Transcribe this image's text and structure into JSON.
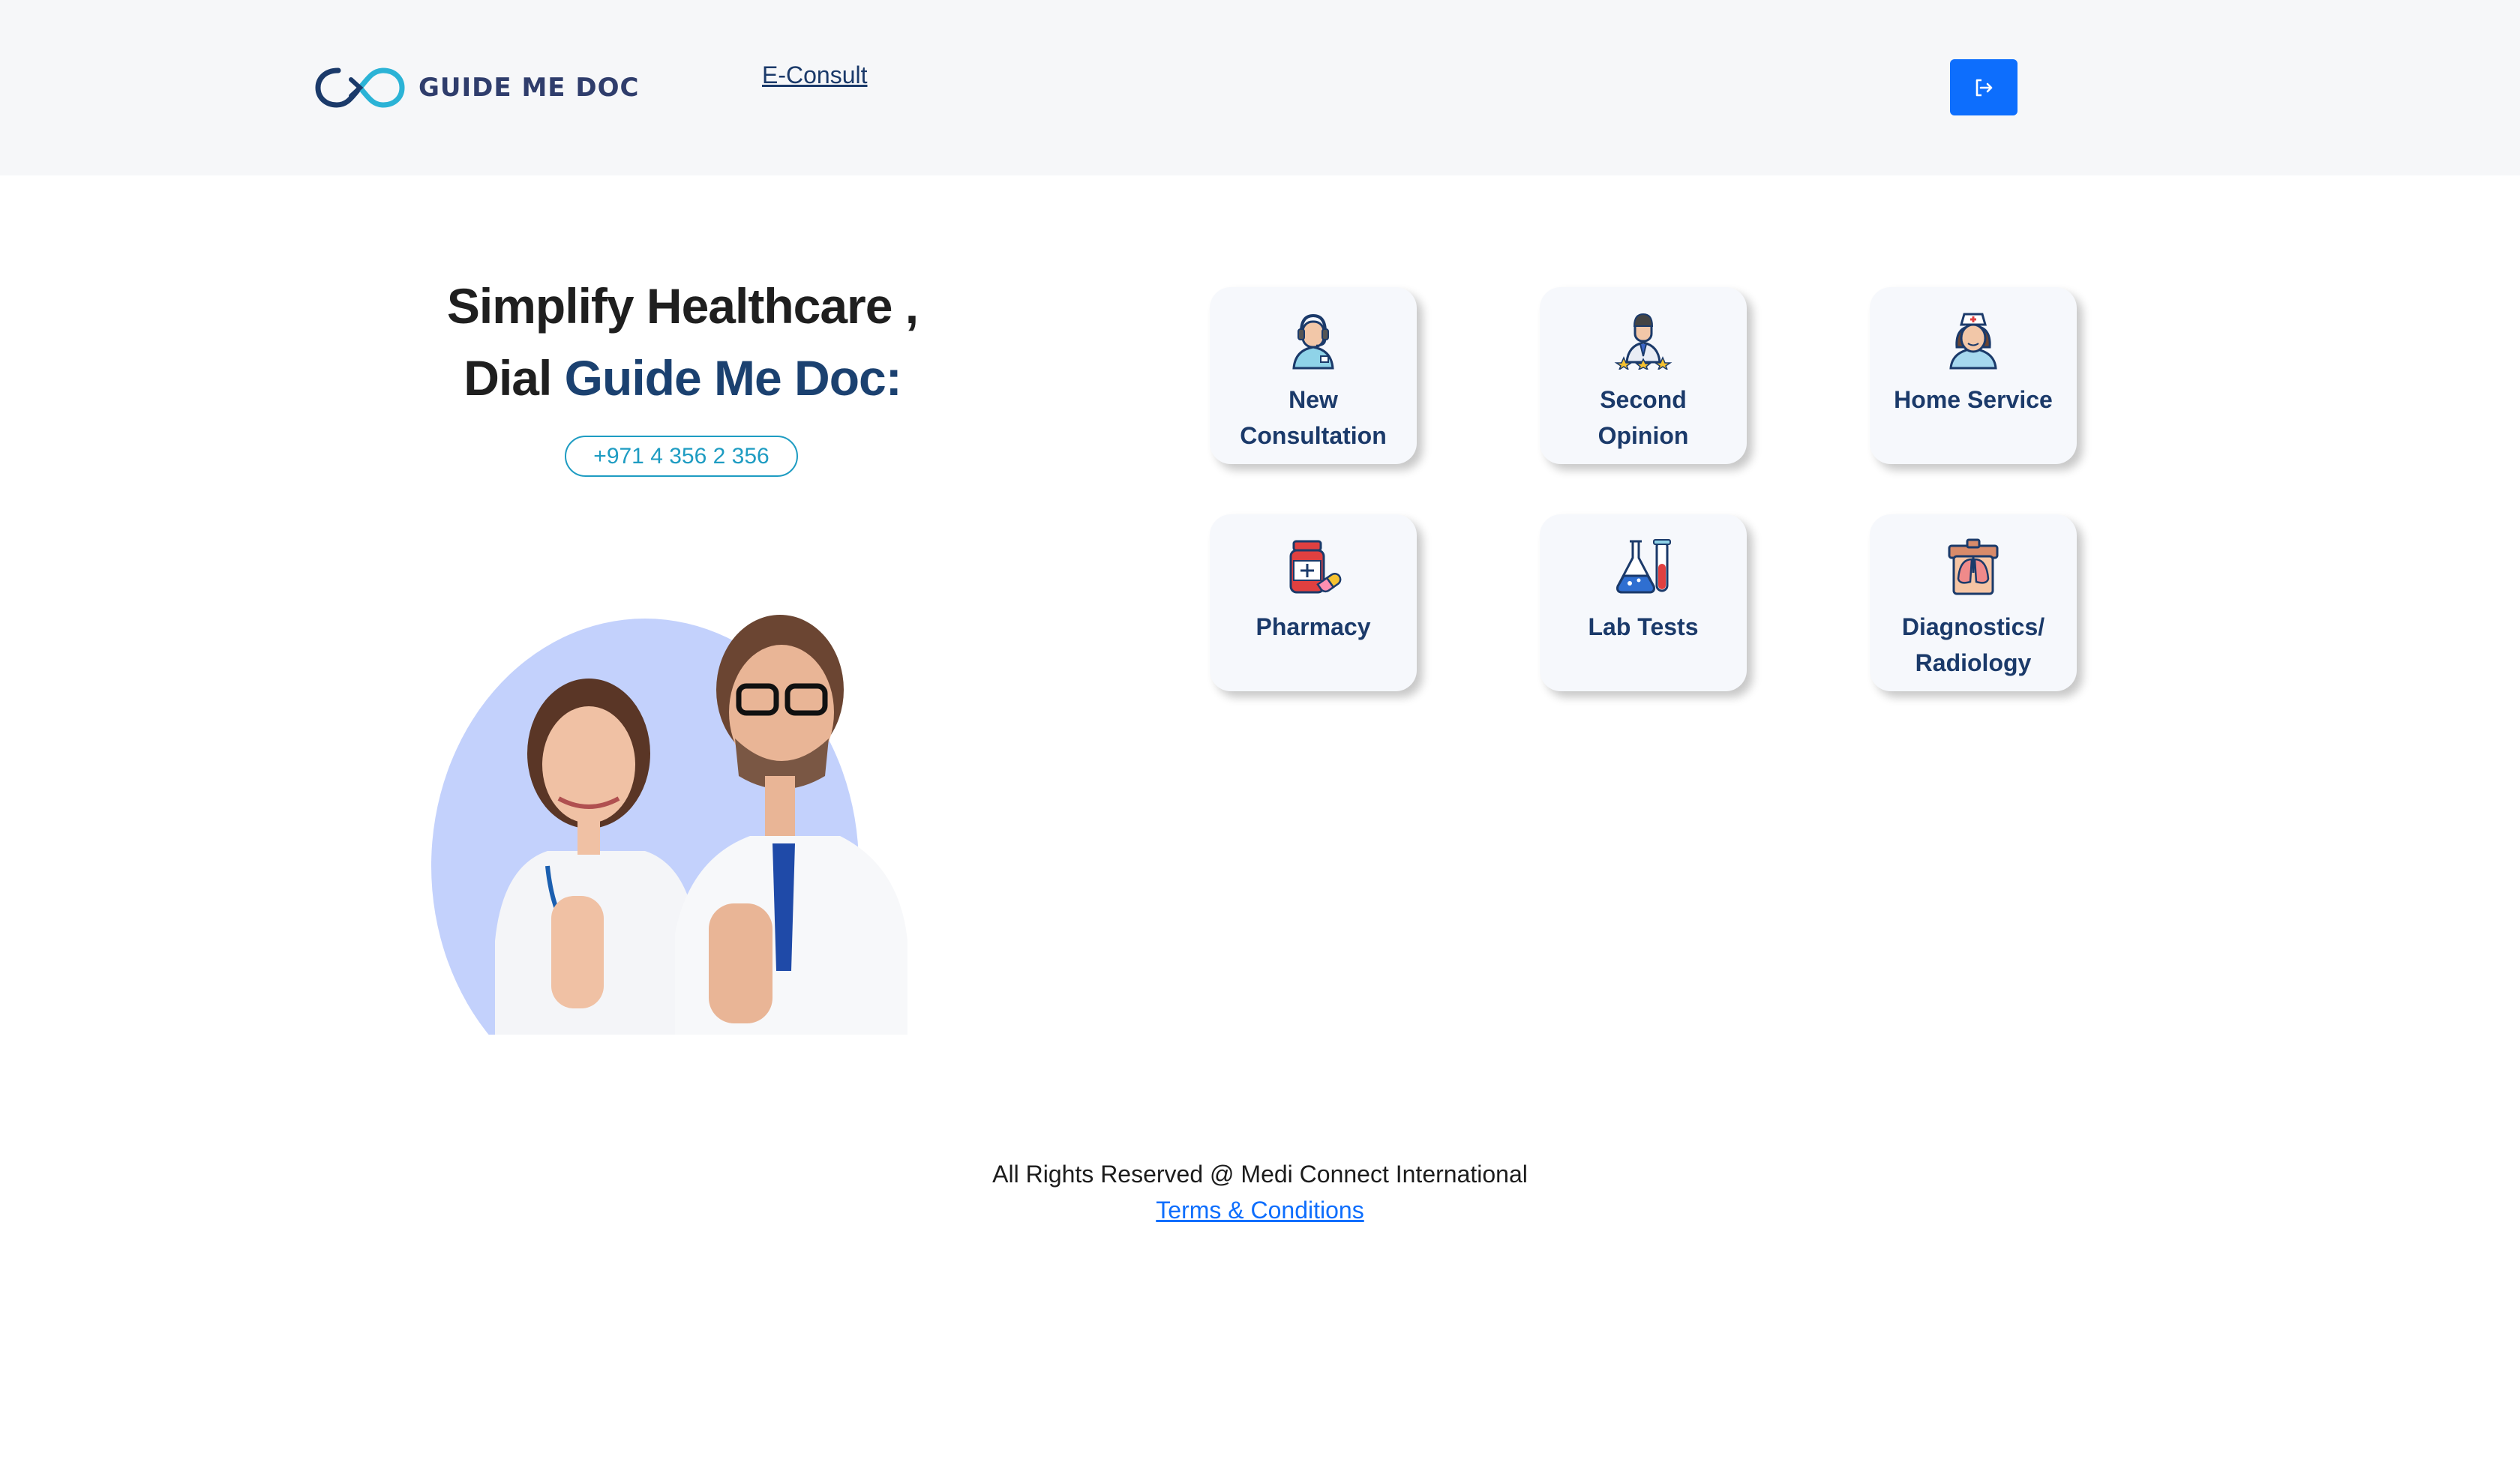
{
  "header": {
    "logo_text": "GUIDE ME DOC",
    "nav_link": "E-Consult",
    "logout_icon": "logout-icon"
  },
  "hero": {
    "title_line1": "Simplify Healthcare ,",
    "title_line2_prefix": "Dial ",
    "title_line2_brand": "Guide Me Doc:",
    "phone": "+971 4 356 2 356"
  },
  "services": [
    {
      "label": "New Consultation",
      "icon": "call-center-doctor-icon"
    },
    {
      "label": "Second Opinion",
      "icon": "rated-doctor-icon"
    },
    {
      "label": "Home Service",
      "icon": "nurse-icon"
    },
    {
      "label": "Pharmacy",
      "icon": "medicine-bottle-icon"
    },
    {
      "label": "Lab Tests",
      "icon": "lab-flask-icon"
    },
    {
      "label": "Diagnostics/ Radiology",
      "icon": "lungs-xray-icon"
    }
  ],
  "footer": {
    "rights": "All Rights Reserved @ Medi Connect International",
    "terms": "Terms & Conditions"
  },
  "colors": {
    "brand_blue": "#1b4170",
    "accent_teal": "#1e9cc2",
    "primary_button": "#0d6efd",
    "header_bg": "#f6f7f9"
  }
}
